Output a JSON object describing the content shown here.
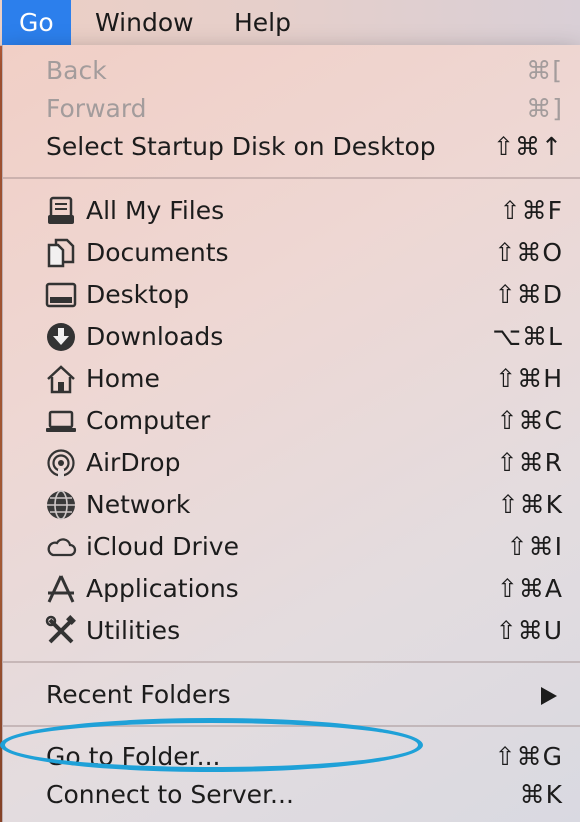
{
  "menubar": {
    "items": [
      {
        "label": "Go",
        "active": true
      },
      {
        "label": "Window",
        "active": false
      },
      {
        "label": "Help",
        "active": false
      }
    ]
  },
  "menu": {
    "section1": [
      {
        "label": "Back",
        "shortcut": "⌘[",
        "enabled": false
      },
      {
        "label": "Forward",
        "shortcut": "⌘]",
        "enabled": false
      },
      {
        "label": "Select Startup Disk on Desktop",
        "shortcut": "⇧⌘↑",
        "enabled": true
      }
    ],
    "places": [
      {
        "label": "All My Files",
        "shortcut": "⇧⌘F",
        "icon": "all-my-files-icon"
      },
      {
        "label": "Documents",
        "shortcut": "⇧⌘O",
        "icon": "documents-icon"
      },
      {
        "label": "Desktop",
        "shortcut": "⇧⌘D",
        "icon": "desktop-icon"
      },
      {
        "label": "Downloads",
        "shortcut": "⌥⌘L",
        "icon": "downloads-icon"
      },
      {
        "label": "Home",
        "shortcut": "⇧⌘H",
        "icon": "home-icon"
      },
      {
        "label": "Computer",
        "shortcut": "⇧⌘C",
        "icon": "computer-icon"
      },
      {
        "label": "AirDrop",
        "shortcut": "⇧⌘R",
        "icon": "airdrop-icon"
      },
      {
        "label": "Network",
        "shortcut": "⇧⌘K",
        "icon": "network-icon"
      },
      {
        "label": "iCloud Drive",
        "shortcut": "⇧⌘I",
        "icon": "icloud-icon"
      },
      {
        "label": "Applications",
        "shortcut": "⇧⌘A",
        "icon": "applications-icon"
      },
      {
        "label": "Utilities",
        "shortcut": "⇧⌘U",
        "icon": "utilities-icon"
      }
    ],
    "recent_folders": {
      "label": "Recent Folders"
    },
    "section4": [
      {
        "label": "Go to Folder...",
        "shortcut": "⇧⌘G"
      },
      {
        "label": "Connect to Server...",
        "shortcut": "⌘K"
      }
    ]
  },
  "colors": {
    "active_menubar": "#2c7fec",
    "annotation_oval": "#1fa1d8",
    "disabled_text": "#a39c9c"
  }
}
